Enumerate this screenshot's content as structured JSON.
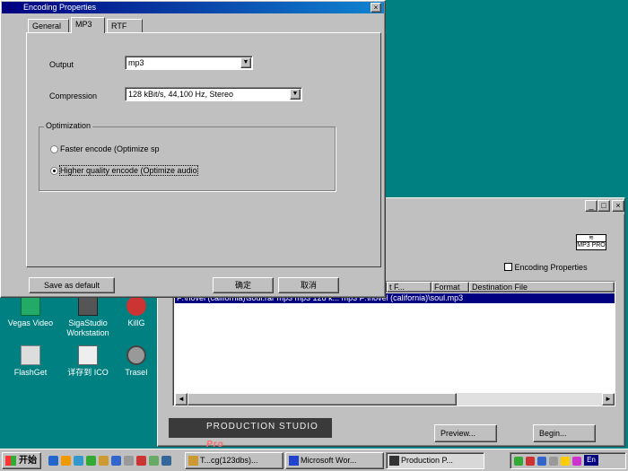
{
  "desktop": {
    "left_labels": [
      "我",
      "我",
      "D",
      "Im",
      "Ex",
      "我"
    ],
    "icons": [
      {
        "label": "Vegas Video"
      },
      {
        "label": "SigaStudio Workstation"
      },
      {
        "label": "KillG"
      },
      {
        "label": "FlashGet"
      },
      {
        "label": "详存到 ICO"
      },
      {
        "label": "TraseI"
      }
    ]
  },
  "production_window": {
    "encoding_properties_label": "Encoding Properties",
    "columns": [
      "",
      "t F...",
      "Format",
      "Destination File"
    ],
    "row": "F:\\novel (california)\\soul.rar  mp3    mp3 128 k... mp3   F:\\novel (california)\\soul.mp3",
    "logo_text": "PRODUCTION STUDIO",
    "logo_pro": "Pro",
    "preview_button": "Preview...",
    "begin_button": "Begin...",
    "mp3pro_badge": "MP3 PRO"
  },
  "dialog": {
    "title": "Encoding Properties",
    "close_glyph": "×",
    "tabs": [
      "General",
      "MP3",
      "RTF"
    ],
    "output_label": "Output",
    "output_value": "mp3",
    "compression_label": "Compression",
    "compression_value": "128 kBit/s, 44,100 Hz, Stereo",
    "group_title": "Optimization",
    "option_fast": "Faster encode (Optimize sp",
    "option_quality": "Higher quality encode (Optimize audio",
    "save_default_button": "Save as default",
    "ok_button": "确定",
    "cancel_button": "取消"
  },
  "taskbar": {
    "start_label": "开始",
    "tasks": [
      {
        "label": "T...cg(123dbs)..."
      },
      {
        "label": "Microsoft Wor..."
      },
      {
        "label": "Production P..."
      }
    ],
    "clock": "En"
  },
  "colors": {
    "desktop": "#008080",
    "title_active": "#000080",
    "selection": "#000080"
  }
}
